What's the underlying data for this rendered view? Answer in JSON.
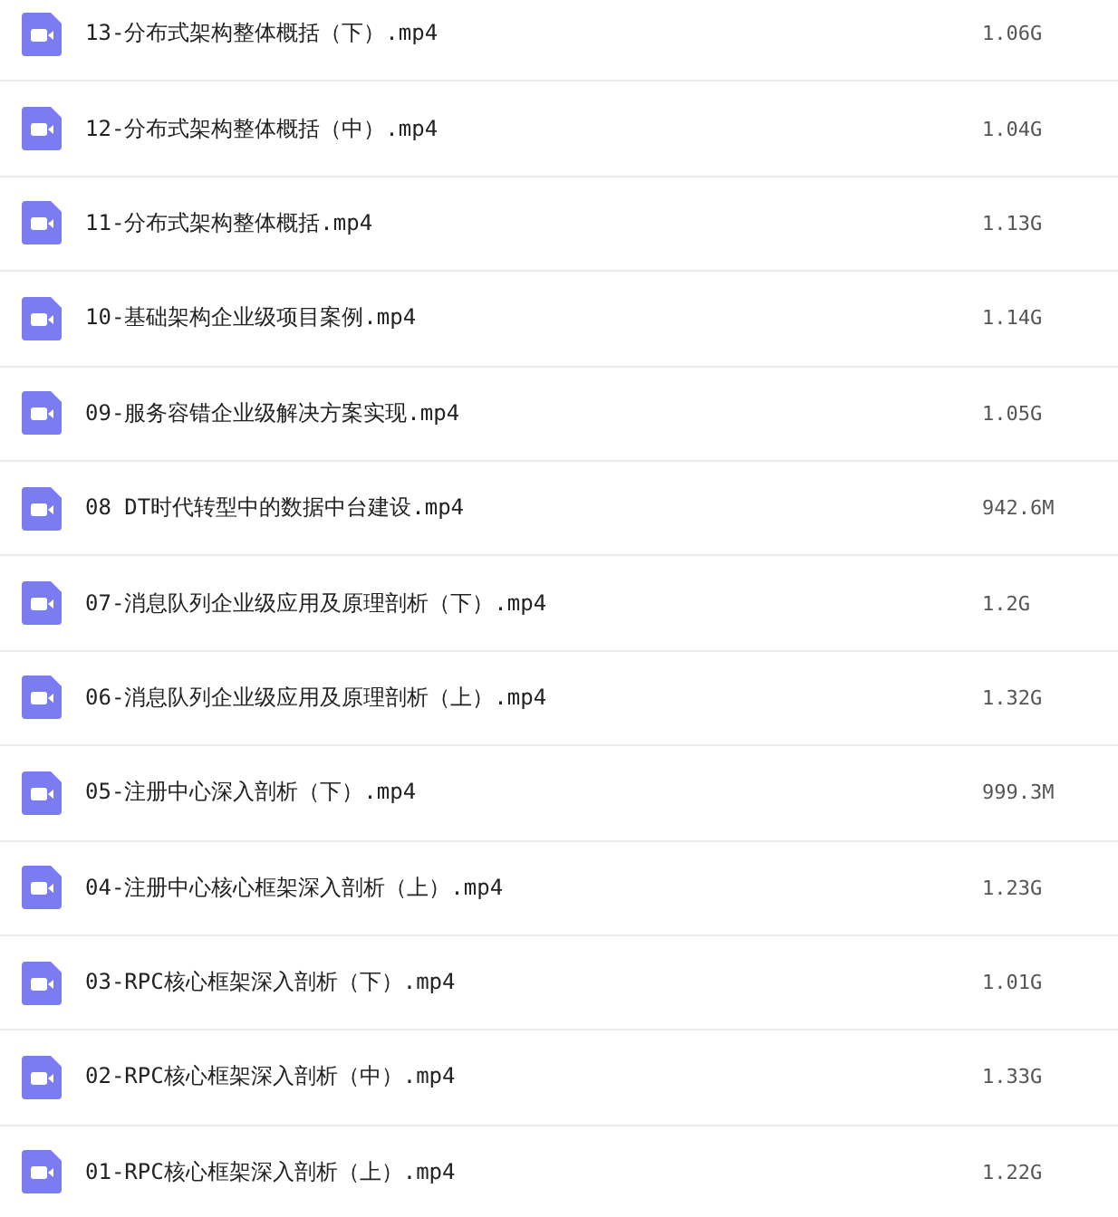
{
  "files": [
    {
      "name": "13-分布式架构整体概括（下）.mp4",
      "size": "1.06G"
    },
    {
      "name": "12-分布式架构整体概括（中）.mp4",
      "size": "1.04G"
    },
    {
      "name": "11-分布式架构整体概括.mp4",
      "size": "1.13G"
    },
    {
      "name": "10-基础架构企业级项目案例.mp4",
      "size": "1.14G"
    },
    {
      "name": "09-服务容错企业级解决方案实现.mp4",
      "size": "1.05G"
    },
    {
      "name": "08 DT时代转型中的数据中台建设.mp4",
      "size": "942.6M"
    },
    {
      "name": "07-消息队列企业级应用及原理剖析（下）.mp4",
      "size": "1.2G"
    },
    {
      "name": "06-消息队列企业级应用及原理剖析（上）.mp4",
      "size": "1.32G"
    },
    {
      "name": "05-注册中心深入剖析（下）.mp4",
      "size": "999.3M"
    },
    {
      "name": "04-注册中心核心框架深入剖析（上）.mp4",
      "size": "1.23G"
    },
    {
      "name": "03-RPC核心框架深入剖析（下）.mp4",
      "size": "1.01G"
    },
    {
      "name": "02-RPC核心框架深入剖析（中）.mp4",
      "size": "1.33G"
    },
    {
      "name": "01-RPC核心框架深入剖析（上）.mp4",
      "size": "1.22G"
    }
  ]
}
